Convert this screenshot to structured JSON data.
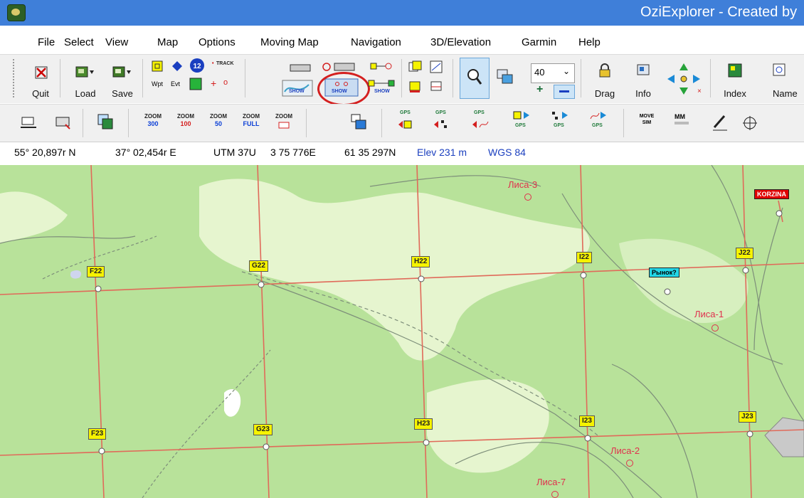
{
  "window": {
    "title": "OziExplorer - Created by"
  },
  "menu": [
    "File",
    "Select",
    "View",
    "Map",
    "Options",
    "Moving Map",
    "Navigation",
    "3D/Elevation",
    "Garmin",
    "Help"
  ],
  "toolbar1": {
    "quit": "Quit",
    "load": "Load",
    "save": "Save",
    "wpt": "Wpt",
    "evt": "Evt",
    "track_cap": "TRACK",
    "track_badge": "12",
    "show": "SHOW",
    "zoom_level": "40",
    "drag": "Drag",
    "info": "Info",
    "index": "Index",
    "name": "Name"
  },
  "toolbar2": {
    "zoom_word": "ZOOM",
    "zoom_values": [
      "300",
      "100",
      "50",
      "FULL"
    ],
    "gps": "GPS",
    "mm": "MM",
    "move_sim": "MOVE SIM"
  },
  "status": {
    "lat": "55° 20,897r N",
    "lon": "37° 02,454r E",
    "utm": "UTM 37U",
    "easting": "3 75 776E",
    "northing": "61 35 297N",
    "elev": "Elev 231 m",
    "datum": "WGS 84"
  },
  "map": {
    "grid_labels": [
      "F22",
      "G22",
      "H22",
      "I22",
      "J22",
      "F23",
      "G23",
      "H23",
      "I23",
      "J23"
    ],
    "waypoints": [
      "Лиса-3",
      "Лиса-1",
      "Лиса-2",
      "Лиса-7"
    ],
    "boxes": [
      {
        "text": "KORZINA",
        "color": "#e00000",
        "text_color": "#ffffff"
      },
      {
        "text": "Рынок?",
        "color": "#22d6e6",
        "text_color": "#000000"
      }
    ],
    "colors": {
      "forest": "#b8e29a",
      "clearing": "#e6f5cf",
      "grid": "#e06a5a",
      "track": "#5a5a5a"
    }
  }
}
